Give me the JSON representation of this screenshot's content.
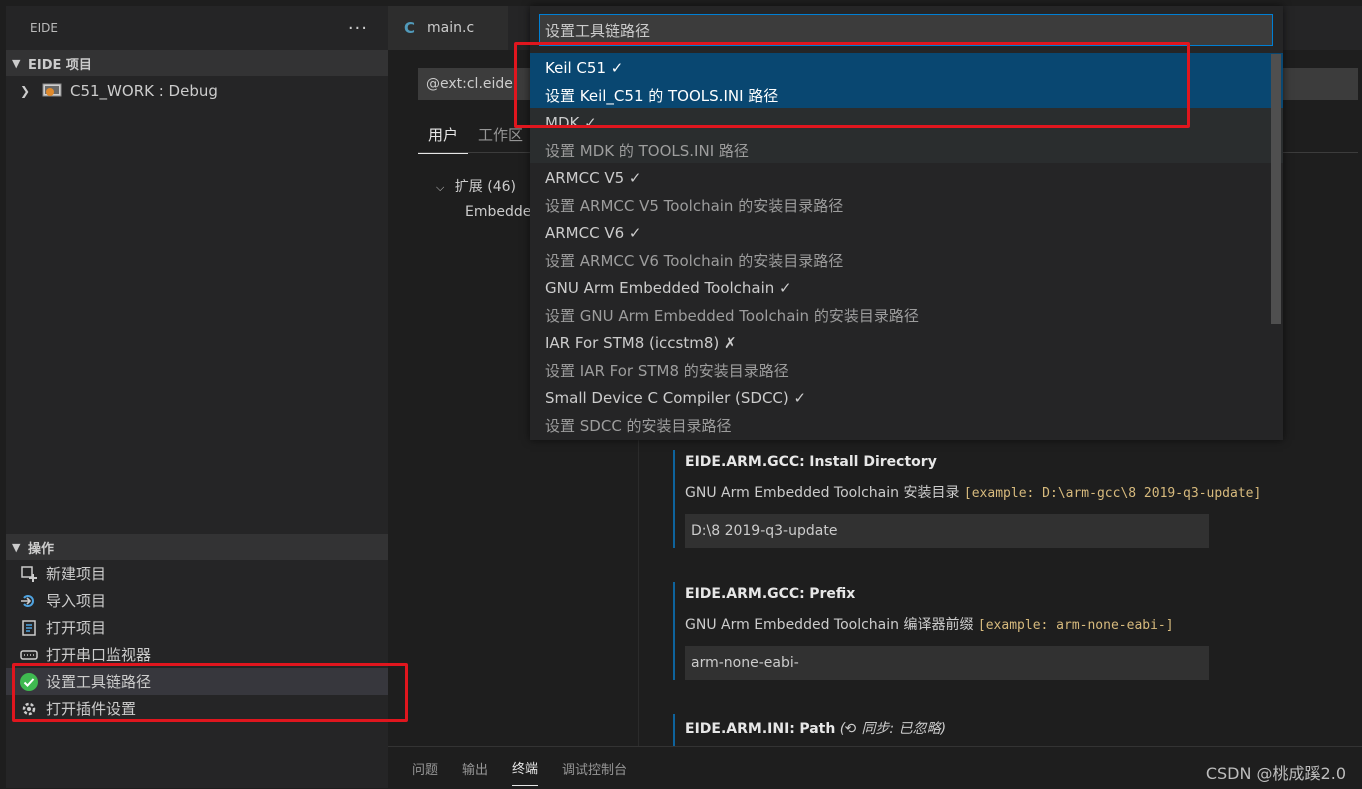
{
  "sidebar": {
    "title": "EIDE",
    "more": "···",
    "project_section": {
      "title": "EIDE 项目"
    },
    "project": {
      "label": "C51_WORK : Debug"
    },
    "actions_section": {
      "title": "操作"
    },
    "actions": [
      {
        "label": "新建项目",
        "icon": "new-project-icon"
      },
      {
        "label": "导入项目",
        "icon": "import-icon"
      },
      {
        "label": "打开项目",
        "icon": "open-project-icon"
      },
      {
        "label": "打开串口监视器",
        "icon": "serial-monitor-icon"
      },
      {
        "label": "设置工具链路径",
        "icon": "check-circle-icon"
      },
      {
        "label": "打开插件设置",
        "icon": "gear-icon"
      }
    ]
  },
  "editor": {
    "tab": {
      "icon": "C",
      "label": "main.c"
    },
    "search_value": "@ext:cl.eide",
    "tabs": {
      "user": "用户",
      "workspace": "工作区"
    },
    "toc": {
      "extensions": "扩展 (46)",
      "embedded": "Embedde"
    },
    "settings": [
      {
        "key": "EIDE.ARM.GCC:",
        "name": "Install Directory",
        "desc": "GNU Arm Embedded Toolchain 安装目录 ",
        "example": "[example: D:\\arm-gcc\\8 2019-q3-update]",
        "value": "D:\\8 2019-q3-update"
      },
      {
        "key": "EIDE.ARM.GCC:",
        "name": "Prefix",
        "desc": "GNU Arm Embedded Toolchain 编译器前缀 ",
        "example": "[example: arm-none-eabi-]",
        "value": "arm-none-eabi-"
      },
      {
        "key": "EIDE.ARM.INI:",
        "name": "Path",
        "sync": "同步: 已忽略)"
      }
    ]
  },
  "quick_pick": {
    "placeholder": "设置工具链路径",
    "items": [
      {
        "label": "Keil C51 ✓",
        "desc": "设置 Keil_C51 的 TOOLS.INI 路径"
      },
      {
        "label": "MDK ✓",
        "desc": "设置 MDK 的 TOOLS.INI 路径"
      },
      {
        "label": "ARMCC V5 ✓",
        "desc": "设置 ARMCC V5 Toolchain 的安装目录路径"
      },
      {
        "label": "ARMCC V6 ✓",
        "desc": "设置 ARMCC V6 Toolchain 的安装目录路径"
      },
      {
        "label": "GNU Arm Embedded Toolchain ✓",
        "desc": "设置 GNU Arm Embedded Toolchain 的安装目录路径"
      },
      {
        "label": "IAR For STM8 (iccstm8) ✗",
        "desc": "设置 IAR For STM8 的安装目录路径"
      },
      {
        "label": "Small Device C Compiler (SDCC) ✓",
        "desc": "设置 SDCC 的安装目录路径"
      }
    ]
  },
  "panel": {
    "tabs": [
      "问题",
      "输出",
      "终端",
      "调试控制台"
    ]
  },
  "watermark": "CSDN @桃成蹊2.0",
  "colors": {
    "accent_red": "#e0161e",
    "focus_blue": "#094771",
    "example_yellow": "#d7ba7d"
  }
}
